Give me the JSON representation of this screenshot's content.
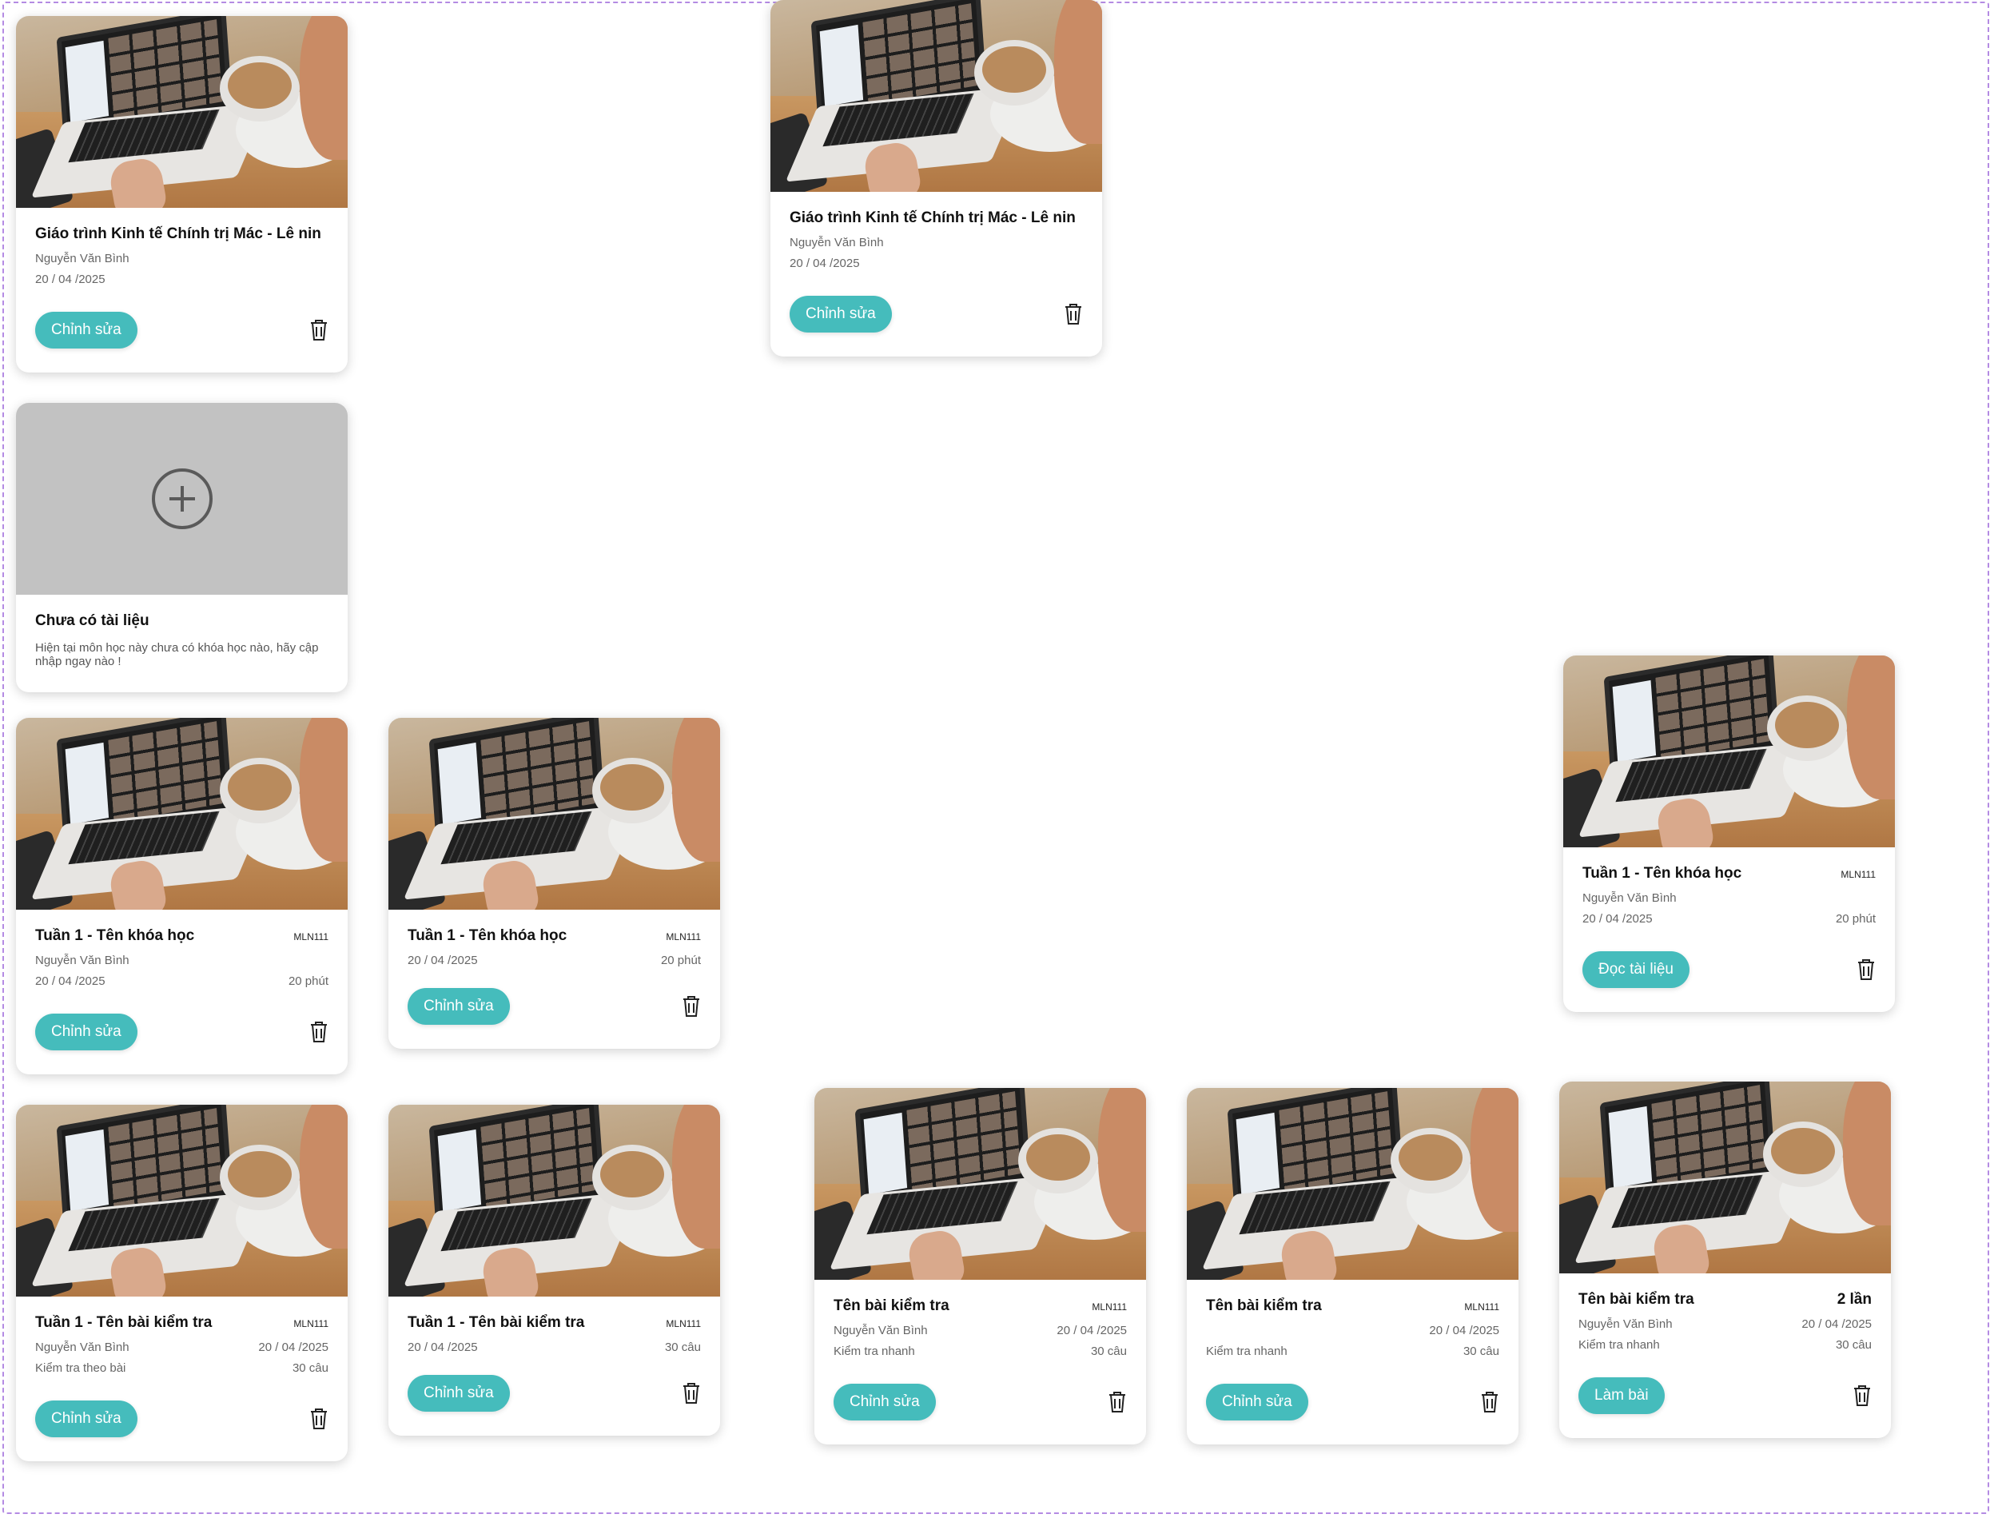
{
  "docs": [
    {
      "title": "Giáo trình Kinh tế Chính trị Mác - Lê nin",
      "author": "Nguyễn Văn Bình",
      "date": "20 / 04 /2025",
      "button": "Chỉnh sửa"
    },
    {
      "title": "Giáo trình Kinh tế Chính trị Mác - Lê nin",
      "author": "Nguyễn Văn Bình",
      "date": "20 / 04 /2025",
      "button": "Chỉnh sửa"
    }
  ],
  "empty": {
    "title": "Chưa có tài liệu",
    "desc": "Hiện tại môn học này chưa có khóa học nào, hãy cập nhập ngay nào !"
  },
  "course_cards": [
    {
      "title": "Tuần 1 - Tên khóa học",
      "code": "MLN111",
      "author": "Nguyễn Văn Bình",
      "date": "20 / 04 /2025",
      "duration": "20 phút",
      "button": "Chỉnh sửa"
    },
    {
      "title": "Tuần 1 - Tên khóa học",
      "code": "MLN111",
      "date": "20 / 04 /2025",
      "duration": "20 phút",
      "button": "Chỉnh sửa"
    },
    {
      "title": "Tuần 1 - Tên khóa học",
      "code": "MLN111",
      "author": "Nguyễn Văn Bình",
      "date": "20 / 04 /2025",
      "duration": "20 phút",
      "button": "Đọc tài liệu"
    }
  ],
  "quiz_cards": [
    {
      "title": "Tuần 1 - Tên bài kiểm tra",
      "code": "MLN111",
      "author": "Nguyễn Văn Bình",
      "date": "20 / 04 /2025",
      "type": "Kiểm tra theo bài",
      "count": "30 câu",
      "button": "Chỉnh sửa"
    },
    {
      "title": "Tuần 1 - Tên bài kiểm tra",
      "code": "MLN111",
      "date": "20 / 04 /2025",
      "count": "30 câu",
      "button": "Chỉnh sửa"
    },
    {
      "title": "Tên bài kiểm tra",
      "code": "MLN111",
      "author": "Nguyễn Văn Bình",
      "date": "20 / 04 /2025",
      "type": "Kiểm tra nhanh",
      "count": "30 câu",
      "button": "Chỉnh sửa"
    },
    {
      "title": "Tên bài kiểm tra",
      "code": "MLN111",
      "date": "20 / 04 /2025",
      "type": "Kiểm tra nhanh",
      "count": "30 câu",
      "button": "Chỉnh sửa"
    },
    {
      "title": "Tên bài kiểm tra",
      "attempts": "2 lần",
      "author": "Nguyễn Văn Bình",
      "date": "20 / 04 /2025",
      "type": "Kiểm tra nhanh",
      "count": "30 câu",
      "button": "Làm bài"
    }
  ],
  "icons": {
    "trash": "trash-icon",
    "add": "plus-circle-icon"
  },
  "colors": {
    "accent": "#45bcbc",
    "frame": "#b48be3",
    "placeholder": "#c2c2c2"
  }
}
